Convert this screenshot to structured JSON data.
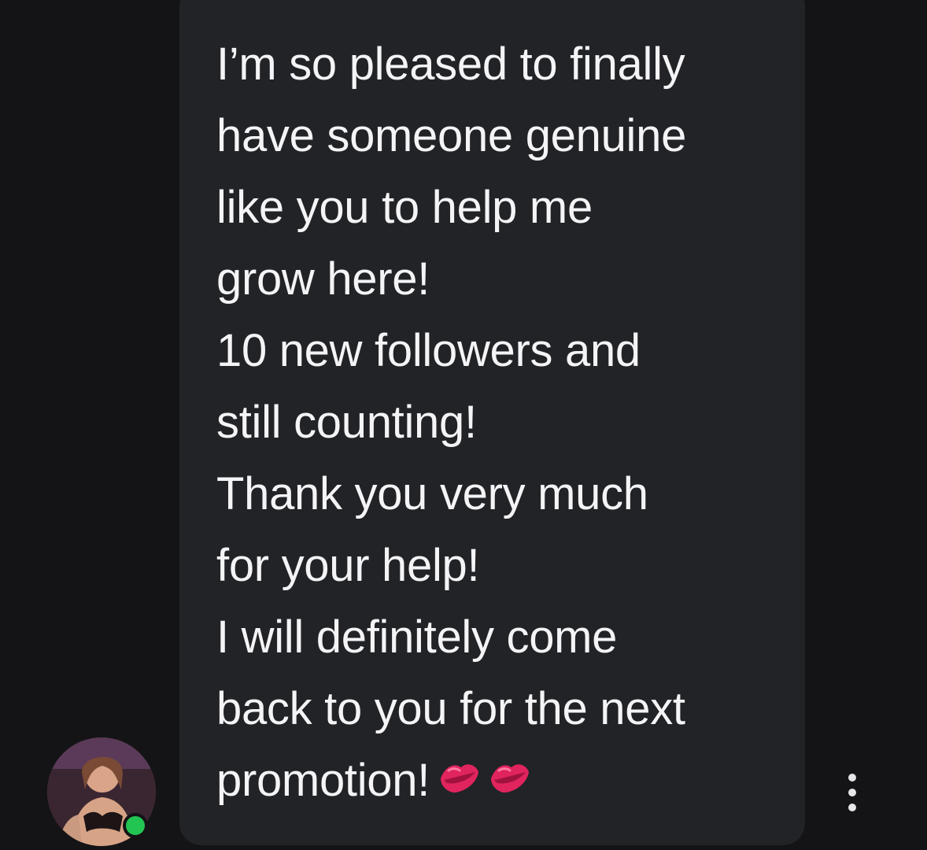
{
  "message": {
    "lines": [
      "I’m so pleased to finally",
      "have someone genuine",
      "like you to help me",
      "grow here!",
      "10 new followers and",
      "still counting!",
      "Thank you very much",
      "for your help!",
      "I will definitely come",
      "back to you for the next",
      "promotion!"
    ],
    "emojis": [
      "lips-icon",
      "lips-icon"
    ]
  },
  "sender": {
    "avatar": "avatar-photo",
    "status": "online",
    "status_color": "#23c552"
  },
  "actions": {
    "more_icon": "more-vertical-icon"
  },
  "colors": {
    "background": "#141416",
    "bubble": "#222327",
    "text": "#f4f4f6",
    "lips": "#e0245e"
  }
}
